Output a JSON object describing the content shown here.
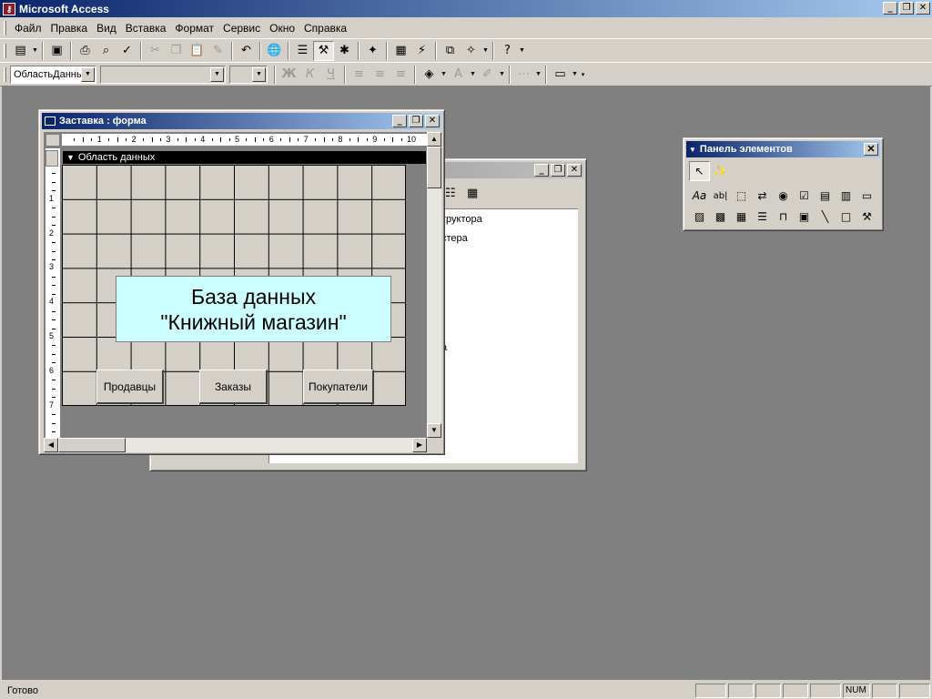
{
  "app": {
    "title": "Microsoft Access",
    "caption_buttons": [
      "_",
      "❐",
      "✕"
    ]
  },
  "menu": {
    "items": [
      {
        "label": "Файл"
      },
      {
        "label": "Правка"
      },
      {
        "label": "Вид"
      },
      {
        "label": "Вставка"
      },
      {
        "label": "Формат"
      },
      {
        "label": "Сервис"
      },
      {
        "label": "Окно"
      },
      {
        "label": "Справка"
      }
    ]
  },
  "format_toolbar": {
    "object_combo": "ОбластьДанны",
    "font_combo": "",
    "size_combo": "",
    "bold": "Ж",
    "italic": "К",
    "underline": "Ч"
  },
  "form_window": {
    "title": "Заставка : форма",
    "section_label": "Область данных",
    "ruler_h": [
      "1",
      "2",
      "3",
      "4",
      "5",
      "6",
      "7",
      "8",
      "9",
      "10"
    ],
    "ruler_v": [
      "1",
      "2",
      "3",
      "4",
      "5",
      "6",
      "7"
    ],
    "title_label_line1": "База данных",
    "title_label_line2": "\"Книжный магазин\"",
    "buttons": [
      {
        "label": "Продавцы"
      },
      {
        "label": "Заказы"
      },
      {
        "label": "Покупатели"
      }
    ]
  },
  "db_window": {
    "items": [
      "труктора",
      "стера",
      "а"
    ]
  },
  "toolbox": {
    "title": "Панель элементов"
  },
  "status": {
    "text": "Готово",
    "num": "NUM"
  },
  "colors": {
    "title_active": "#0a246a",
    "title_inactive": "#808080",
    "label_bg": "#ccffff",
    "mdi_bg": "#808080"
  }
}
